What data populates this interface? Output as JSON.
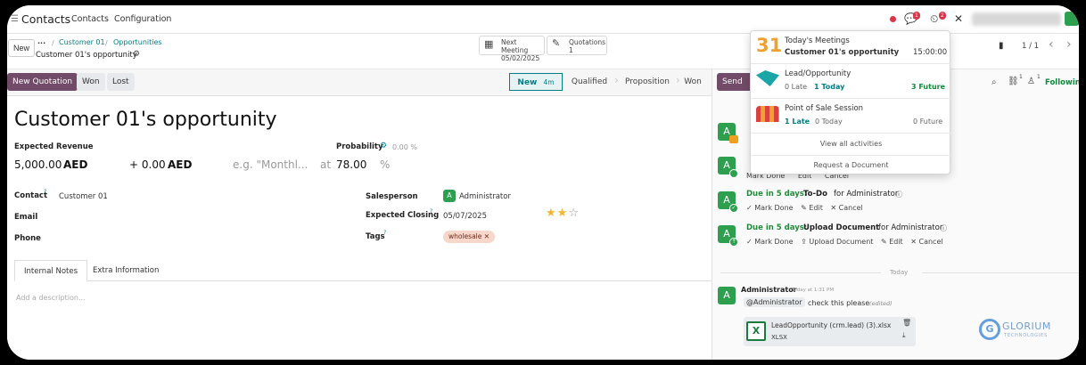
{
  "navbar": {
    "app": "Contacts",
    "menus": [
      "Contacts",
      "Configuration"
    ],
    "messages_badge": "1",
    "activities_badge": "2"
  },
  "control_panel": {
    "new_label": "New",
    "more_label": "···",
    "breadcrumb": [
      "Customer 01",
      "Opportunities"
    ],
    "record_name": "Customer 01's opportunity",
    "smart_buttons": [
      {
        "label": "Next Meeting",
        "value": "05/02/2025"
      },
      {
        "label": "Quotations",
        "value": "1"
      }
    ],
    "pager": "1 / 1"
  },
  "statusbar": {
    "buttons": [
      "New Quotation",
      "Won",
      "Lost"
    ],
    "stages": [
      {
        "label": "New",
        "duration": "4m"
      },
      {
        "label": "Qualified"
      },
      {
        "label": "Proposition"
      },
      {
        "label": "Won"
      }
    ]
  },
  "form": {
    "title": "Customer 01's opportunity",
    "expected_revenue_label": "Expected Revenue",
    "expected_revenue": "5,000.00",
    "currency": "AED",
    "recurring_amount": "+ 0.00",
    "recurring_currency": "AED",
    "recurring_placeholder": "e.g. \"Monthl...",
    "at_label": "at",
    "probability_label": "Probability",
    "probability_auto": "0.00 %",
    "probability": "78.00",
    "percent": "%",
    "contact_label": "Contact",
    "contact": "Customer 01",
    "email_label": "Email",
    "phone_label": "Phone",
    "salesperson_label": "Salesperson",
    "salesperson": "Administrator",
    "salesperson_initial": "A",
    "expected_closing_label": "Expected Closing",
    "expected_closing": "05/07/2025",
    "priority_stars": 2,
    "priority_max": 3,
    "tags_label": "Tags",
    "tag": "wholesale",
    "tabs": [
      "Internal Notes",
      "Extra Information"
    ],
    "description_placeholder": "Add a description..."
  },
  "chatter": {
    "send_label": "Send m",
    "following_label": "Following",
    "attachments_count": "1",
    "followers_count": "1",
    "activities": [
      {
        "due": "Due in 5 days:",
        "type": "To-Do",
        "assignee": "for Administrator"
      },
      {
        "due": "Due in 5 days:",
        "type": "Upload Document",
        "assignee": "for Administrator"
      }
    ],
    "partial_actions": [
      "Mark Done",
      "Edit",
      "Cancel"
    ],
    "actions_todo": [
      "Mark Done",
      "Edit",
      "Cancel"
    ],
    "actions_upload": [
      "Mark Done",
      "Upload Document",
      "Edit",
      "Cancel"
    ],
    "today_label": "Today",
    "message": {
      "author": "Administrator",
      "time": "Today at 1:31 PM",
      "mention": "@Administrator",
      "text": "check this please",
      "edited": "(edited)",
      "attachment_name": "LeadOpportunity (crm.lead) (3).xlsx",
      "attachment_type": "XLSX"
    },
    "avatar_initial": "A"
  },
  "activity_popup": {
    "meeting": {
      "day": "31",
      "title": "Today's Meetings",
      "subject": "Customer 01's opportunity",
      "time": "15:00:00"
    },
    "rows": [
      {
        "title": "Lead/Opportunity",
        "late": "0 Late",
        "today": "1 Today",
        "future": "3 Future"
      },
      {
        "title": "Point of Sale Session",
        "late": "1 Late",
        "today": "0 Today",
        "future": "0 Future"
      }
    ],
    "view_all": "View all activities",
    "request_doc": "Request a Document"
  },
  "watermark": {
    "brand": "GLORIUM",
    "sub": "TECHNOLOGIES"
  },
  "colors": {
    "brand": "#714b67",
    "teal": "#017e84",
    "green": "#2e9e4f",
    "red_badge": "#d9344a"
  }
}
